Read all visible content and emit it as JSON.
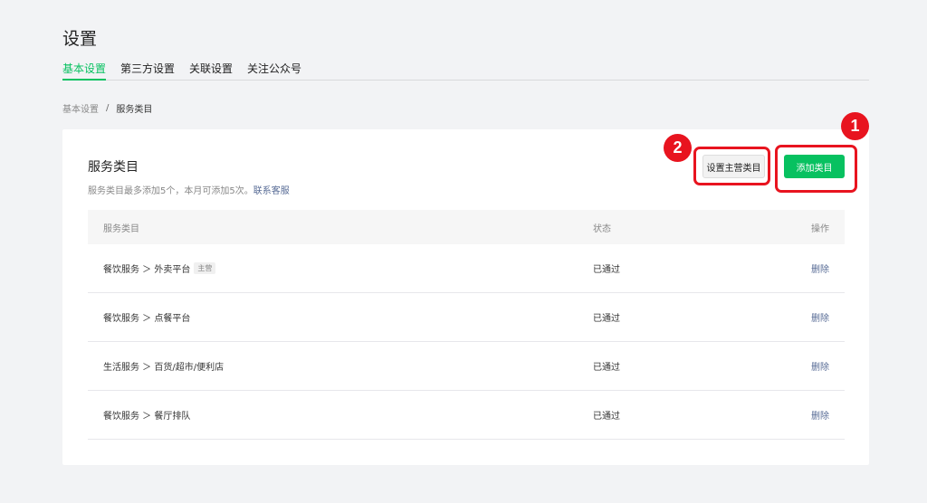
{
  "page": {
    "title": "设置"
  },
  "tabs": [
    {
      "label": "基本设置",
      "active": true
    },
    {
      "label": "第三方设置",
      "active": false
    },
    {
      "label": "关联设置",
      "active": false
    },
    {
      "label": "关注公众号",
      "active": false
    }
  ],
  "breadcrumb": {
    "parent": "基本设置",
    "separator": "/",
    "current": "服务类目"
  },
  "card": {
    "title": "服务类目",
    "desc_text": "服务类目最多添加5个，本月可添加5次。",
    "desc_link": "联系客服",
    "btn_set_main": "设置主营类目",
    "btn_add": "添加类目"
  },
  "annotations": {
    "badge_1": "1",
    "badge_2": "2",
    "color": "#e8141f"
  },
  "table": {
    "headers": {
      "name": "服务类目",
      "status": "状态",
      "op": "操作"
    },
    "rows": [
      {
        "name": "餐饮服务 ＞ 外卖平台",
        "tag": "主营",
        "status": "已通过",
        "op": "删除"
      },
      {
        "name": "餐饮服务 ＞ 点餐平台",
        "status": "已通过",
        "op": "删除"
      },
      {
        "name": "生活服务 ＞ 百货/超市/便利店",
        "status": "已通过",
        "op": "删除"
      },
      {
        "name": "餐饮服务 ＞ 餐厅排队",
        "status": "已通过",
        "op": "删除"
      }
    ]
  },
  "colors": {
    "accent": "#07c160",
    "link": "#576b95"
  }
}
